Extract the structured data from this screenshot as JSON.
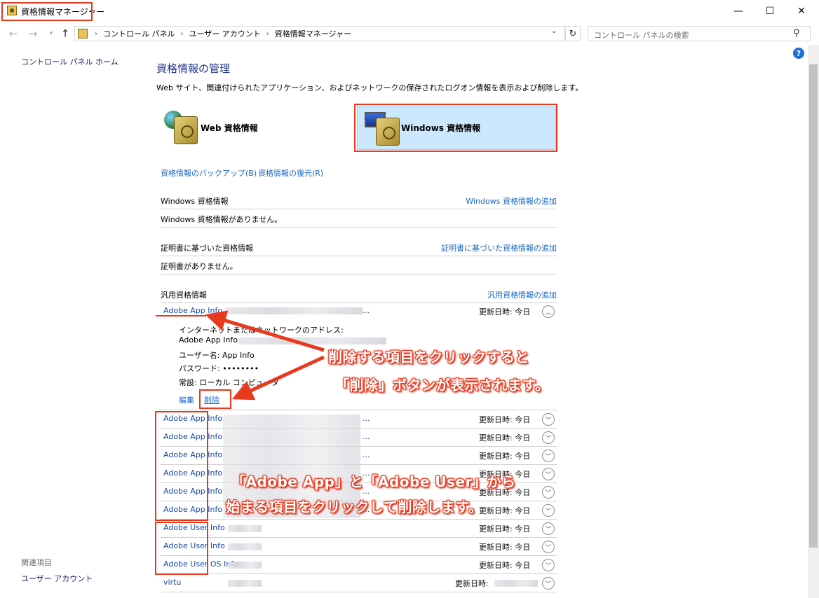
{
  "window": {
    "title": "資格情報マネージャー",
    "minimize": "—",
    "maximize": "☐",
    "close": "✕"
  },
  "address": {
    "crumbs": [
      "コントロール パネル",
      "ユーザー アカウント",
      "資格情報マネージャー"
    ],
    "search_placeholder": "コントロール パネルの検索"
  },
  "left": {
    "home_link": "コントロール パネル ホーム",
    "related_heading": "関連項目",
    "related_link": "ユーザー アカウント"
  },
  "main": {
    "title": "資格情報の管理",
    "description": "Web サイト、関連付けられたアプリケーション、およびネットワークの保存されたログオン情報を表示および削除します。",
    "web_button": "Web 資格情報",
    "windows_button": "Windows 資格情報",
    "backup_link": "資格情報のバックアップ(B)",
    "restore_link": "資格情報の復元(R)",
    "sections": {
      "windows": {
        "heading": "Windows 資格情報",
        "add": "Windows 資格情報の追加",
        "empty": "Windows 資格情報がありません。"
      },
      "cert": {
        "heading": "証明書に基づいた資格情報",
        "add": "証明書に基づいた資格情報の追加",
        "empty": "証明書がありません。"
      },
      "generic": {
        "heading": "汎用資格情報",
        "add": "汎用資格情報の追加"
      }
    },
    "expanded": {
      "name": "Adobe App Info",
      "ellipsis": "...",
      "date": "更新日時:  今日",
      "address_label": "インターネットまたはネットワークのアドレス:",
      "address_value": "Adobe App Info",
      "username": "ユーザー名:  App Info",
      "password": "パスワード:  ••••••••",
      "persistence": "常設:  ローカル コンピュータ",
      "edit": "編集",
      "delete": "削除"
    },
    "rows": [
      {
        "name": "Adobe App Info",
        "suffix": "...",
        "date": "更新日時:  今日"
      },
      {
        "name": "Adobe App Info",
        "suffix": "...",
        "date": "更新日時:  今日"
      },
      {
        "name": "Adobe App Info",
        "suffix": "...",
        "date": "更新日時:  今日"
      },
      {
        "name": "Adobe App Info",
        "suffix": "...",
        "date": "更新日時:  今日"
      },
      {
        "name": "Adobe App Info",
        "suffix": "...",
        "date": "更新日時:  今日"
      },
      {
        "name": "Adobe App Info",
        "suffix": "...",
        "date": "更新日時:  今日"
      },
      {
        "name": "Adobe User Info",
        "suffix": "",
        "date": "更新日時:  今日"
      },
      {
        "name": "Adobe User Info",
        "suffix": "",
        "date": "更新日時:  今日"
      },
      {
        "name": "Adobe User OS Info",
        "suffix": "",
        "date": "更新日時:  今日"
      },
      {
        "name": "virtu",
        "suffix": "",
        "date": "更新日時:"
      }
    ]
  },
  "annotations": {
    "note1_line1": "削除する項目をクリックすると",
    "note1_line2": "「削除」ボタンが表示されます。",
    "note2_line1": "「Adobe App」と「Adobe User」から",
    "note2_line2": "始まる項目をクリックして削除します。"
  },
  "help": "?"
}
